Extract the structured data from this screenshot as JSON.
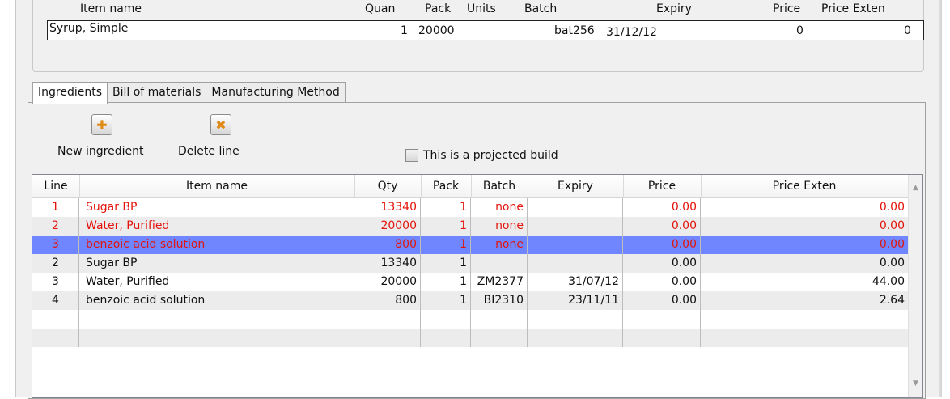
{
  "top": {
    "headers": [
      "Item name",
      "Quan",
      "Pack",
      "Units",
      "Batch",
      "Expiry",
      "Price",
      "Price Exten"
    ],
    "row": {
      "item_name": "Syrup, Simple",
      "quantity": "1",
      "pack": "20000",
      "units": "",
      "batch": "bat256",
      "expiry": "31/12/12",
      "price": "0",
      "price_exten": "0"
    }
  },
  "tabs": [
    "Ingredients",
    "Bill of materials",
    "Manufacturing Method"
  ],
  "toolbar": {
    "new_ingredient_label": "New ingredient",
    "delete_line_label": "Delete line",
    "projected_build_label": "This is a projected build",
    "projected_build_checked": false
  },
  "grid": {
    "headers": [
      "Line",
      "Item name",
      "Qty",
      "Pack",
      "Batch",
      "Expiry",
      "Price",
      "Price Exten"
    ],
    "rows": [
      {
        "line": "1",
        "item": "Sugar BP",
        "qty": "13340",
        "pack": "1",
        "batch": "none",
        "expiry": "",
        "price": "0.00",
        "ext": "0.00",
        "highlight": "red"
      },
      {
        "line": "2",
        "item": "Water, Purified",
        "qty": "20000",
        "pack": "1",
        "batch": "none",
        "expiry": "",
        "price": "0.00",
        "ext": "0.00",
        "highlight": "red"
      },
      {
        "line": "3",
        "item": "benzoic acid solution",
        "qty": "800",
        "pack": "1",
        "batch": "none",
        "expiry": "",
        "price": "0.00",
        "ext": "0.00",
        "highlight": "red-selected"
      },
      {
        "line": "2",
        "item": "Sugar BP",
        "qty": "13340",
        "pack": "1",
        "batch": "",
        "expiry": "",
        "price": "0.00",
        "ext": "0.00",
        "highlight": "none"
      },
      {
        "line": "3",
        "item": "Water, Purified",
        "qty": "20000",
        "pack": "1",
        "batch": "ZM2377",
        "expiry": "31/07/12",
        "price": "0.00",
        "ext": "44.00",
        "highlight": "none"
      },
      {
        "line": "4",
        "item": "benzoic acid solution",
        "qty": "800",
        "pack": "1",
        "batch": "BI2310",
        "expiry": "23/11/11",
        "price": "0.00",
        "ext": "2.64",
        "highlight": "none"
      }
    ]
  },
  "colors": {
    "error_text": "#e3140c",
    "selection": "#6f86ff"
  },
  "icons": {
    "new_ingredient": "plus-icon",
    "delete_line": "x-icon",
    "scroll_up": "triangle-up-icon",
    "scroll_down": "triangle-down-icon"
  }
}
